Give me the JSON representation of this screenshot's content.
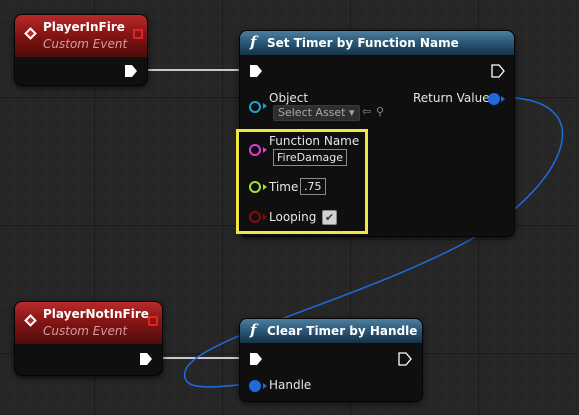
{
  "nodes": {
    "player_in_fire": {
      "title": "PlayerInFire",
      "subtitle": "Custom Event"
    },
    "player_not_in_fire": {
      "title": "PlayerNotInFire",
      "subtitle": "Custom Event"
    },
    "set_timer": {
      "title": "Set Timer by Function Name",
      "object_label": "Object",
      "object_select": "Select Asset",
      "return_label": "Return Value",
      "function_name_label": "Function Name",
      "function_name_value": "FireDamage",
      "time_label": "Time",
      "time_value": ".75",
      "looping_label": "Looping",
      "looping_checked": true
    },
    "clear_timer": {
      "title": "Clear Timer by Handle",
      "handle_label": "Handle"
    }
  },
  "icons": {
    "event": "event-diamond-icon",
    "function": "function-f-icon",
    "exec": "exec-arrow-icon",
    "delegate": "delegate-pin-icon"
  },
  "colors": {
    "event_header": "#b92a2a",
    "function_header": "#2a5675",
    "object_pin": "#1fa2d6",
    "string_pin": "#e03bd6",
    "float_pin": "#9fe03a",
    "bool_pin": "#8c0a0a",
    "handle_pin": "#1e6be0",
    "highlight": "#f2e641"
  }
}
